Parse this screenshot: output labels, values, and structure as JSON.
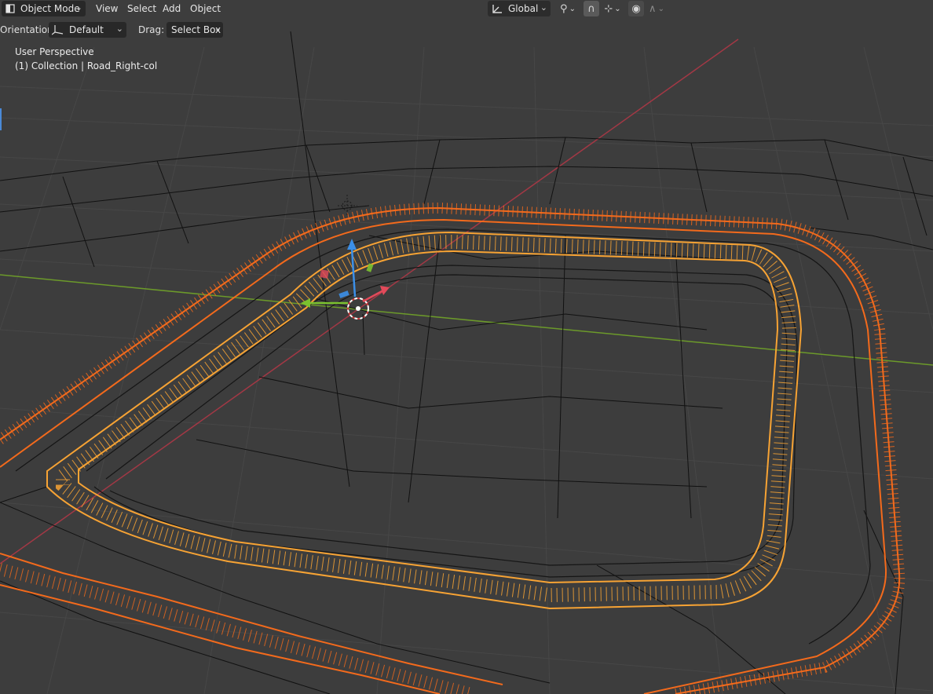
{
  "header": {
    "mode_label": "Object Mode",
    "menus": [
      "View",
      "Select",
      "Add",
      "Object"
    ],
    "transform_orientation": "Global"
  },
  "toolbar": {
    "orientation_label": "Orientation:",
    "orientation_value": "Default",
    "drag_label": "Drag:",
    "drag_value": "Select Box"
  },
  "viewport": {
    "perspective": "User Perspective",
    "collection": "(1) Collection | Road_Right-col"
  },
  "colors": {
    "background": "#3d3d3d",
    "grid": "#474747",
    "x_axis": "#a33845",
    "y_axis": "#6c9a2a",
    "wire": "#0f0f0f",
    "road_outer": "#f36a1c",
    "road_inner": "#f7a334"
  },
  "icons": [
    "object-mode-icon",
    "transform-orientation-icon",
    "pivot-icon",
    "snap-icon",
    "snap-target-icon",
    "proportional-edit-icon",
    "falloff-icon",
    "orientation-gizmo-icon",
    "camera-icon",
    "3d-cursor-icon"
  ]
}
